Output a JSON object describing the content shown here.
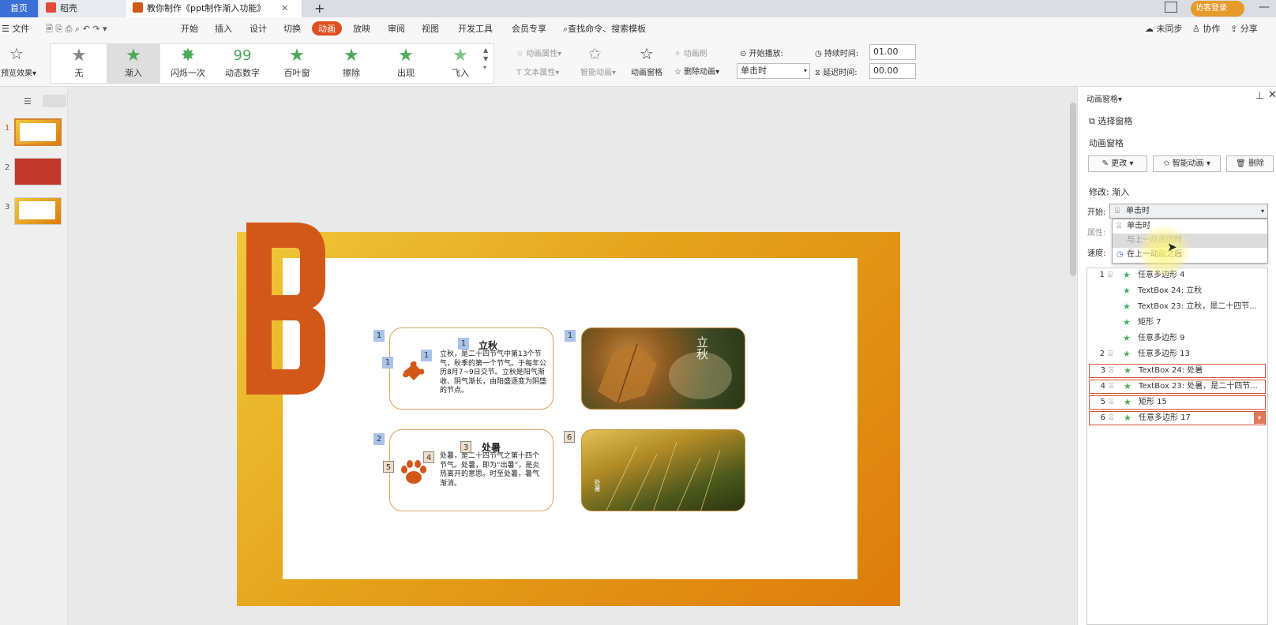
{
  "tabs": {
    "home": "首页",
    "t2": "稻壳",
    "t3": "教你制作《ppt制作渐入功能》",
    "plus": "+"
  },
  "titlebar": {
    "login": "访客登录"
  },
  "menu": {
    "file": "文件",
    "items": [
      "开始",
      "插入",
      "设计",
      "切换",
      "动画",
      "放映",
      "审阅",
      "视图",
      "开发工具",
      "会员专享"
    ],
    "search": "查找命令、搜索模板",
    "sync": "未同步",
    "collab": "协作",
    "share": "分享"
  },
  "ribbon": {
    "preview": "预览效果",
    "gallery": [
      "无",
      "渐入",
      "闪烁一次",
      "动态数字",
      "百叶窗",
      "擦除",
      "出现",
      "飞入"
    ],
    "anim_props": "动画属性",
    "text_props": "文本属性",
    "smart": "智能动画",
    "pane": "动画窗格",
    "brush": "动画刷",
    "delete": "删除动画",
    "start_play": "开始播放:",
    "start_value": "单击时",
    "duration_label": "持续时间:",
    "duration_value": "01.00",
    "delay_label": "延迟时间:",
    "delay_value": "00.00"
  },
  "slides": {
    "nums": [
      "1",
      "2",
      "3"
    ]
  },
  "slide": {
    "card1": {
      "title": "立秋",
      "text": "立秋，是二十四节气中第13个节气，秋季的第一个节气。于每年公历8月7~9日交节。立秋是阳气渐收、阴气渐长，由阳盛逐变为阴盛的节点。",
      "tags": [
        "1",
        "1",
        "1",
        "1"
      ]
    },
    "card2": {
      "title": "处暑",
      "text": "处暑，是二十四节气之第十四个节气。处暑，即为“出暑”，是炎热离开的意思。时至处暑，暑气渐消。",
      "tags": [
        "2",
        "3",
        "4",
        "5",
        "6"
      ]
    },
    "photo1_text": "立秋",
    "photo2_text": "处暑"
  },
  "pane": {
    "title": "动画窗格",
    "select_pane": "选择窗格",
    "subtitle": "动画窗格",
    "change": "更改",
    "smart": "智能动画",
    "delete": "删除",
    "modify": "修改: 渐入",
    "start_label": "开始:",
    "start_value": "单击时",
    "prop_label": "属性:",
    "speed_label": "速度:",
    "options": [
      "单击时",
      "与上一动画同时",
      "在上一动画之后"
    ],
    "items": [
      {
        "num": "1",
        "label": "任意多边形 4",
        "hl": false
      },
      {
        "num": "",
        "label": "TextBox 24: 立秋",
        "hl": false
      },
      {
        "num": "",
        "label": "TextBox 23: 立秋，是二十四节...",
        "hl": false
      },
      {
        "num": "",
        "label": "矩形 7",
        "hl": false
      },
      {
        "num": "",
        "label": "任意多边形 9",
        "hl": false
      },
      {
        "num": "2",
        "label": "任意多边形 13",
        "hl": false
      },
      {
        "num": "3",
        "label": "TextBox 24: 处暑",
        "hl": true
      },
      {
        "num": "4",
        "label": "TextBox 23: 处暑，是二十四节...",
        "hl": true
      },
      {
        "num": "5",
        "label": "矩形 15",
        "hl": true
      },
      {
        "num": "6",
        "label": "任意多边形 17",
        "hl": true
      }
    ]
  },
  "colors": {
    "accent": "#e0501f",
    "brand_orange": "#d2581a",
    "anim_green": "#4caa5a"
  }
}
